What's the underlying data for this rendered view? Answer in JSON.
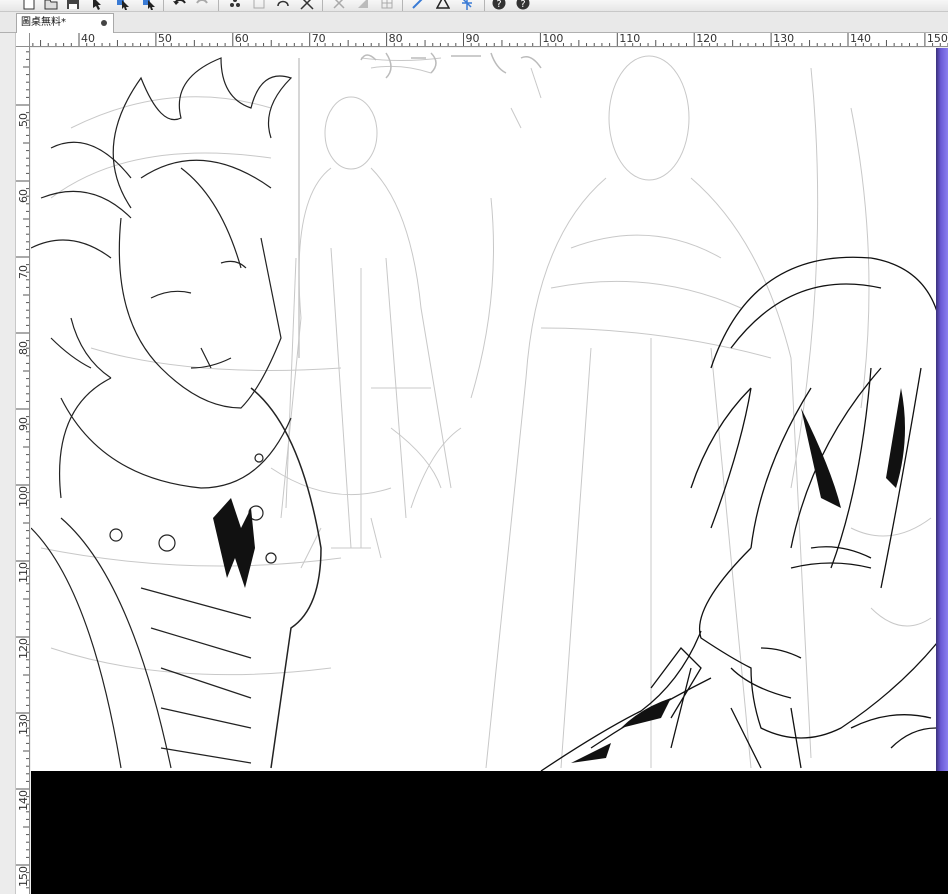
{
  "document": {
    "tab_title": "圖桌無料*"
  },
  "rulers": {
    "horizontal_labels": [
      "40",
      "50",
      "60",
      "70",
      "80",
      "90",
      "100",
      "110",
      "120",
      "130",
      "140",
      "150"
    ],
    "vertical_labels": [
      "50",
      "60",
      "70",
      "80",
      "90",
      "100",
      "110",
      "120",
      "130",
      "140",
      "150"
    ]
  },
  "toolbar": {
    "icons": [
      "new-file-icon",
      "open-file-icon",
      "save-icon",
      "select-icon",
      "select-layer-icon",
      "select-object-icon",
      "undo-icon",
      "redo-icon",
      "transform-icon",
      "crop-icon",
      "lasso-icon",
      "expand-icon",
      "clear-icon",
      "fill-icon",
      "grid-icon",
      "ruler-icon",
      "perspective-icon",
      "symmetry-icon",
      "help-icon",
      "info-icon"
    ]
  },
  "colors": {
    "canvas_edge_accent": "#6b5cd6",
    "paper": "#ffffff",
    "pasteboard": "#000000"
  }
}
